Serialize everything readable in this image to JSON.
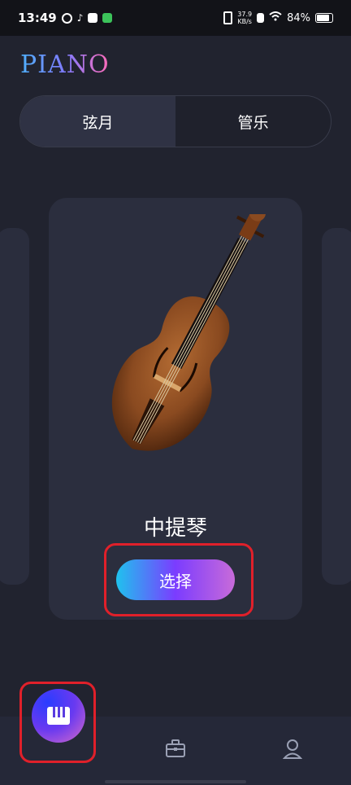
{
  "status": {
    "time": "13:49",
    "speed_value": "37.9",
    "speed_unit": "KB/s",
    "battery": "84%"
  },
  "logo": "PIANO",
  "tabs": [
    {
      "label": "弦月",
      "active": true
    },
    {
      "label": "管乐",
      "active": false
    }
  ],
  "instrument": {
    "name": "中提琴",
    "select_label": "选择"
  },
  "nav": {
    "items": [
      "piano-icon",
      "toolbox-icon",
      "profile-icon"
    ]
  },
  "colors": {
    "background": "#21232f",
    "card": "#2b2e3e",
    "highlight": "#e0202a"
  }
}
